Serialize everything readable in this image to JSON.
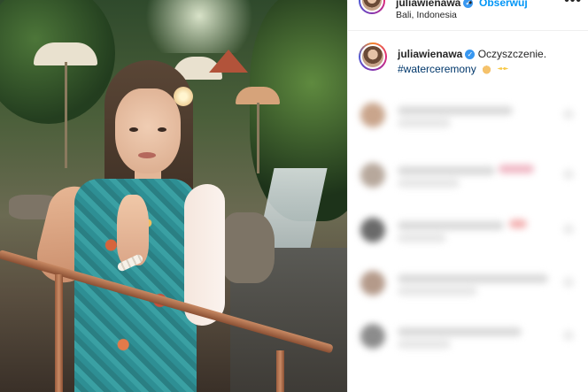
{
  "post": {
    "username": "juliawienawa",
    "verified_mark": "✓",
    "separator": "•",
    "follow_label": "Obserwuj",
    "location": "Bali, Indonesia",
    "more_icon": "•••"
  },
  "caption": {
    "username": "juliawienawa",
    "text": "Oczyszczenie.",
    "hashtag": "#waterceremony",
    "emojis": [
      "pray-icon",
      "sparkles-icon"
    ]
  },
  "colors": {
    "link_blue": "#0095f6",
    "hashtag_blue": "#00376b",
    "verified_blue": "#3897f0",
    "text_dark": "#262626"
  }
}
